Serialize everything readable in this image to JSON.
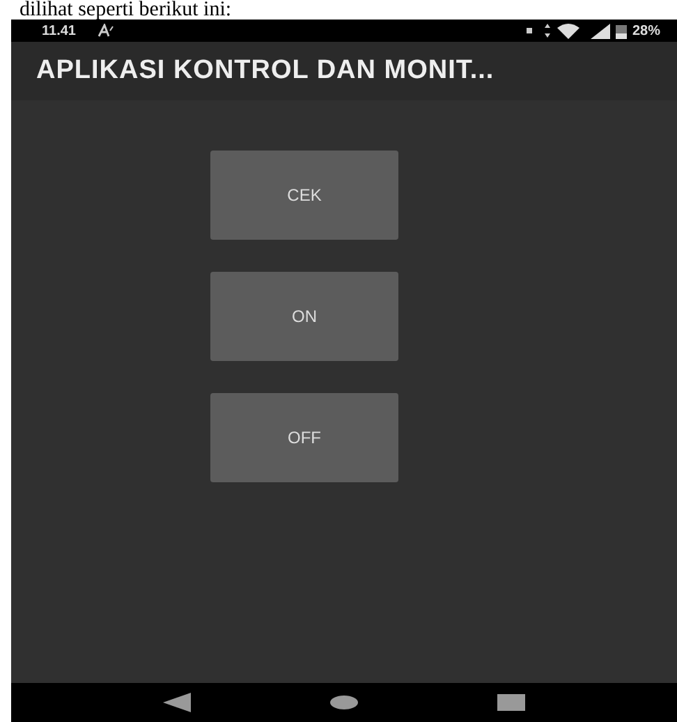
{
  "document_text": "dilihat seperti berikut ini:",
  "status_bar": {
    "time": "11.41",
    "battery": "28%"
  },
  "app_bar": {
    "title": "APLIKASI KONTROL DAN MONIT..."
  },
  "buttons": [
    {
      "label": "CEK"
    },
    {
      "label": "ON"
    },
    {
      "label": "OFF"
    }
  ]
}
